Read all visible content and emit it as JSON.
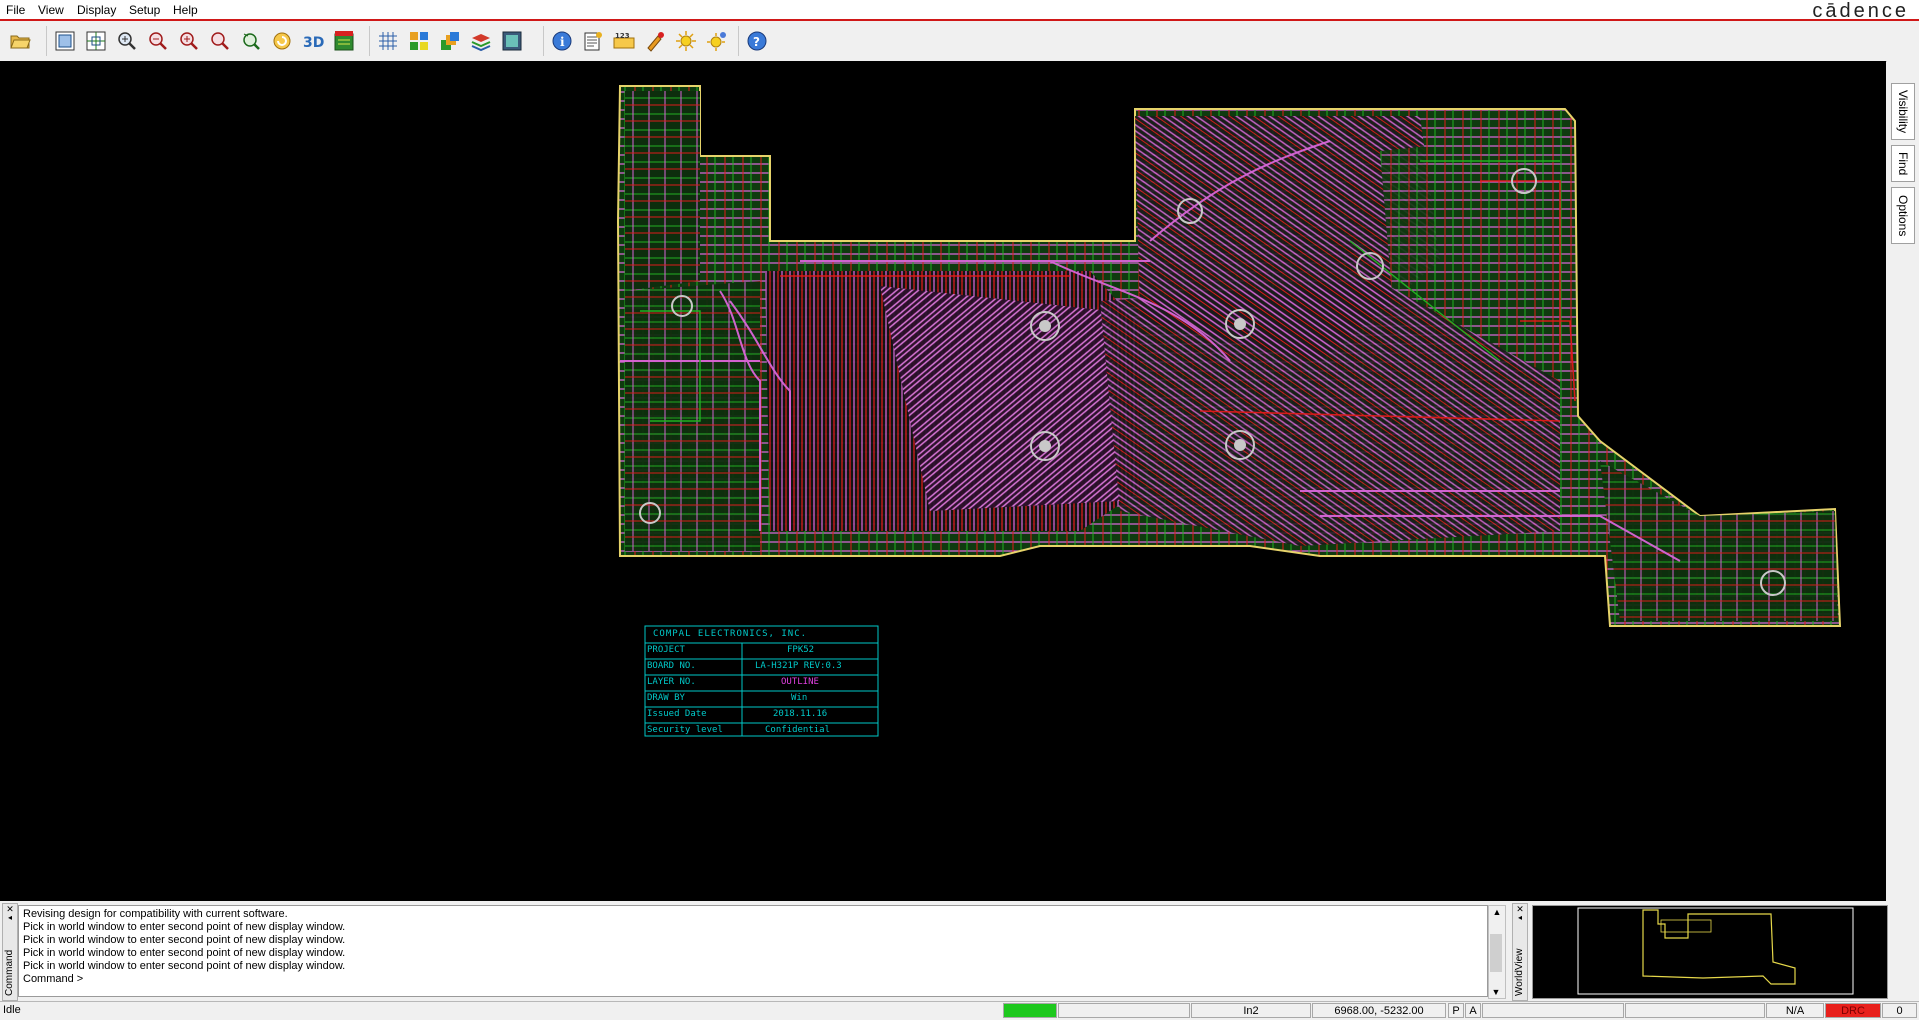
{
  "menu": [
    {
      "label": "File"
    },
    {
      "label": "View"
    },
    {
      "label": "Display"
    },
    {
      "label": "Setup"
    },
    {
      "label": "Help"
    }
  ],
  "brand": "cādence",
  "toolbar": {
    "icons": [
      "open-folder-icon",
      "zoom-fit-icon",
      "zoom-world-icon",
      "zoom-in-icon",
      "zoom-out-icon",
      "zoom-points-icon",
      "zoom-previous-icon",
      "zoom-prev-icon",
      "refresh-icon",
      "3d-view-icon",
      "flip-icon",
      "grid-icon",
      "color-icon",
      "layer-icon",
      "stack-icon",
      "shadow-icon",
      "info-icon",
      "report-icon",
      "number-icon",
      "highlight-icon",
      "sun-icon",
      "sun-settings-icon",
      "help-icon"
    ]
  },
  "right_tabs": [
    "Visibility",
    "Find",
    "Options"
  ],
  "titleblock": {
    "company": "COMPAL ELECTRONICS, INC.",
    "rows": [
      {
        "label": "PROJECT",
        "value": "FPK52"
      },
      {
        "label": "BOARD NO.",
        "value": "LA-H321P  REV:0.3"
      },
      {
        "label": "LAYER NO.",
        "value": "OUTLINE"
      },
      {
        "label": "DRAW BY",
        "value": "Win"
      },
      {
        "label": "Issued Date",
        "value": "2018.11.16"
      },
      {
        "label": "Security level",
        "value": "Confidential"
      }
    ]
  },
  "command": {
    "side_label": "Command",
    "lines": [
      "Revising design for compatibility with current software.",
      "Pick in world window to enter second point of new display window.",
      "Pick in world window to enter second point of new display window.",
      "Pick in world window to enter second point of new display window.",
      "Pick in world window to enter second point of new display window.",
      "Command >"
    ]
  },
  "worldview": {
    "side_label": "WorldView"
  },
  "status": {
    "state": "Idle",
    "units": "In2",
    "coords": "6968.00, -5232.00",
    "p": "P",
    "a": "A",
    "na": "N/A",
    "drc": "DRC",
    "count": "0"
  },
  "colors": {
    "canvas": "#000000",
    "board_green": "#1f6b1f",
    "trace_magenta": "#e070e0",
    "trace_red": "#e01a1a",
    "trace_green": "#22b022",
    "outline_yellow": "#e6d36a",
    "title_cyan": "#00c8c8",
    "drc_red": "#e8201c",
    "status_green": "#1ec81e"
  }
}
